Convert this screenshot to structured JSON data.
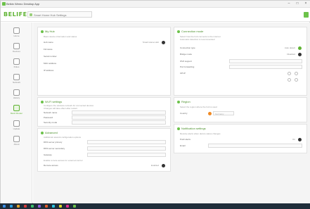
{
  "window": {
    "title": "Belkin Wemo Desktop App"
  },
  "topbar": {
    "logo": "BELIFE",
    "device_text": "Smart Home Hub Settings"
  },
  "sidebar": {
    "items": [
      {
        "label": "Home",
        "icon": "home-icon"
      },
      {
        "label": "Devices",
        "icon": "device-icon"
      },
      {
        "label": "Rules",
        "icon": "rules-icon"
      },
      {
        "label": "Network",
        "icon": "network-icon"
      },
      {
        "label": "History",
        "icon": "history-icon"
      },
      {
        "label": "Mesh Router",
        "icon": "router-icon",
        "active": true
      },
      {
        "label": "Update",
        "icon": "update-icon"
      },
      {
        "label": "About",
        "icon": "about-icon"
      }
    ]
  },
  "panels": {
    "general": {
      "title": "My Hub",
      "desc": "Basic device information and status",
      "rows": [
        {
          "label": "Hub name",
          "value": "Smart Home Hub"
        },
        {
          "label": "Firmware"
        },
        {
          "label": "Serial number"
        },
        {
          "label": "MAC address"
        },
        {
          "label": "IP address"
        }
      ]
    },
    "wifi": {
      "title": "Wi-Fi settings",
      "desc1": "Configure the wireless network for connected devices",
      "desc2": "Changes will take effect after restart",
      "rows": [
        {
          "label": "Network name"
        },
        {
          "label": "Password"
        },
        {
          "label": "Security mode"
        },
        {
          "label": "Channel"
        }
      ]
    },
    "advanced": {
      "title": "Advanced",
      "desc": "Additional network configuration options",
      "rows": [
        {
          "label": "DNS server primary"
        },
        {
          "label": "DNS server secondary"
        },
        {
          "label": "Gateway"
        }
      ],
      "note": "Enable remote access for external control",
      "toggle_label": "Remote access",
      "toggle_text": "Enabled"
    },
    "connection": {
      "title": "Connection mode",
      "desc1": "Select how the hub connects to the internet",
      "desc2": "Automatic detection is recommended",
      "rows": [
        {
          "label": "Connection type",
          "value": "Auto detect"
        },
        {
          "label": "Bridge mode",
          "value": "Disabled"
        },
        {
          "label": "IPv6 support"
        },
        {
          "label": "Port forwarding"
        },
        {
          "label": "UPnP"
        }
      ]
    },
    "region": {
      "title": "Region",
      "desc": "Select the region where the hub is used",
      "label": "Country",
      "value": "Germany"
    },
    "notifications": {
      "title": "Notification settings",
      "desc": "Receive alerts when device status changes",
      "rows": [
        {
          "label": "Push alerts",
          "value": "On"
        },
        {
          "label": "Email"
        }
      ]
    }
  },
  "colors": {
    "accent": "#5fb333",
    "orange": "#f08a24"
  }
}
